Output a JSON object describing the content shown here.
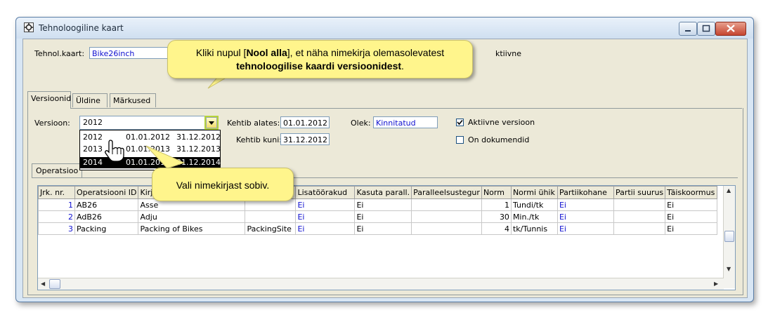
{
  "window": {
    "title": "Tehnoloogiline kaart"
  },
  "header": {
    "tech_card_label": "Tehnol.kaart:",
    "tech_card_value": "Bike26inch",
    "active_label_partial": "ktiivne"
  },
  "tabs": [
    {
      "label": "Versioonid"
    },
    {
      "label": "Üldine"
    },
    {
      "label": "Märkused"
    }
  ],
  "version_form": {
    "version_label": "Versioon:",
    "version_value": "2012",
    "valid_from_label": "Kehtib alates:",
    "valid_from_value": "01.01.2012",
    "valid_to_label": "Kehtib kuni:",
    "valid_to_value": "31.12.2012",
    "status_label": "Olek:",
    "status_value": "Kinnitatud",
    "active_version_label": "Aktiivne versioon",
    "has_documents_label": "On dokumendid"
  },
  "dropdown": {
    "options": [
      {
        "version": "2012",
        "from": "01.01.2012",
        "to": "31.12.2012"
      },
      {
        "version": "2013",
        "from": "01.01.2013",
        "to": "31.12.2013"
      },
      {
        "version": "2014",
        "from": "01.01.2014",
        "to": "31.12.2014"
      }
    ]
  },
  "subtab": {
    "label": "Operatsioo"
  },
  "grid": {
    "columns": [
      "Jrk. nr.",
      "Operatsiooni ID",
      "Kirje",
      "",
      "Lisatöörakud",
      "Kasuta parall.",
      "Paralleelsustegur",
      "Norm",
      "Normi ühik",
      "Partiikohane",
      "Partii suurus",
      "Täiskoormus"
    ],
    "rows": [
      [
        "1",
        "AB26",
        "Asse",
        "",
        "Ei",
        "Ei",
        "",
        "1",
        "Tundi/tk",
        "Ei",
        "",
        "Ei"
      ],
      [
        "2",
        "AdB26",
        "Adju",
        "",
        "Ei",
        "Ei",
        "",
        "30",
        "Min./tk",
        "Ei",
        "",
        "Ei"
      ],
      [
        "3",
        "Packing",
        "Packing of Bikes",
        "PackingSite",
        "Ei",
        "Ei",
        "",
        "4",
        "tk/Tunnis",
        "Ei",
        "",
        "Ei"
      ]
    ]
  },
  "callouts": {
    "top_part1": "Kliki nupul [",
    "top_bold1": "Nool alla",
    "top_part2": "], et näha nimekirja olemasolevatest",
    "top_bold2": "tehnoloogilise kaardi versioonidest",
    "top_part3": ".",
    "bottom": "Vali nimekirjast sobiv."
  },
  "colors": {
    "callout_bg": "#fff58c",
    "link_blue": "#1010d0",
    "window_frame": "#d8e6f4"
  }
}
